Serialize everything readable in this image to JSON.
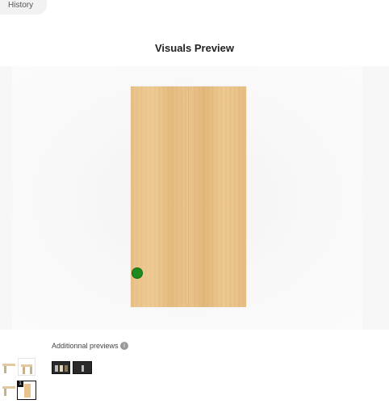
{
  "history": {
    "label": "History"
  },
  "header": {
    "title": "Visuals Preview"
  },
  "preview": {
    "hotspot_color": "#1f8a1f",
    "wood_color": "#ecc690"
  },
  "additional": {
    "label": "Additionnal previews",
    "info_icon": "info-icon",
    "thumbnails": [
      "additional-preview-1",
      "additional-preview-2"
    ]
  },
  "variants": {
    "selected_badge": "1",
    "items": [
      "variant-thumbnail-1",
      "variant-thumbnail-2",
      "variant-thumbnail-3",
      "variant-thumbnail-4"
    ]
  }
}
